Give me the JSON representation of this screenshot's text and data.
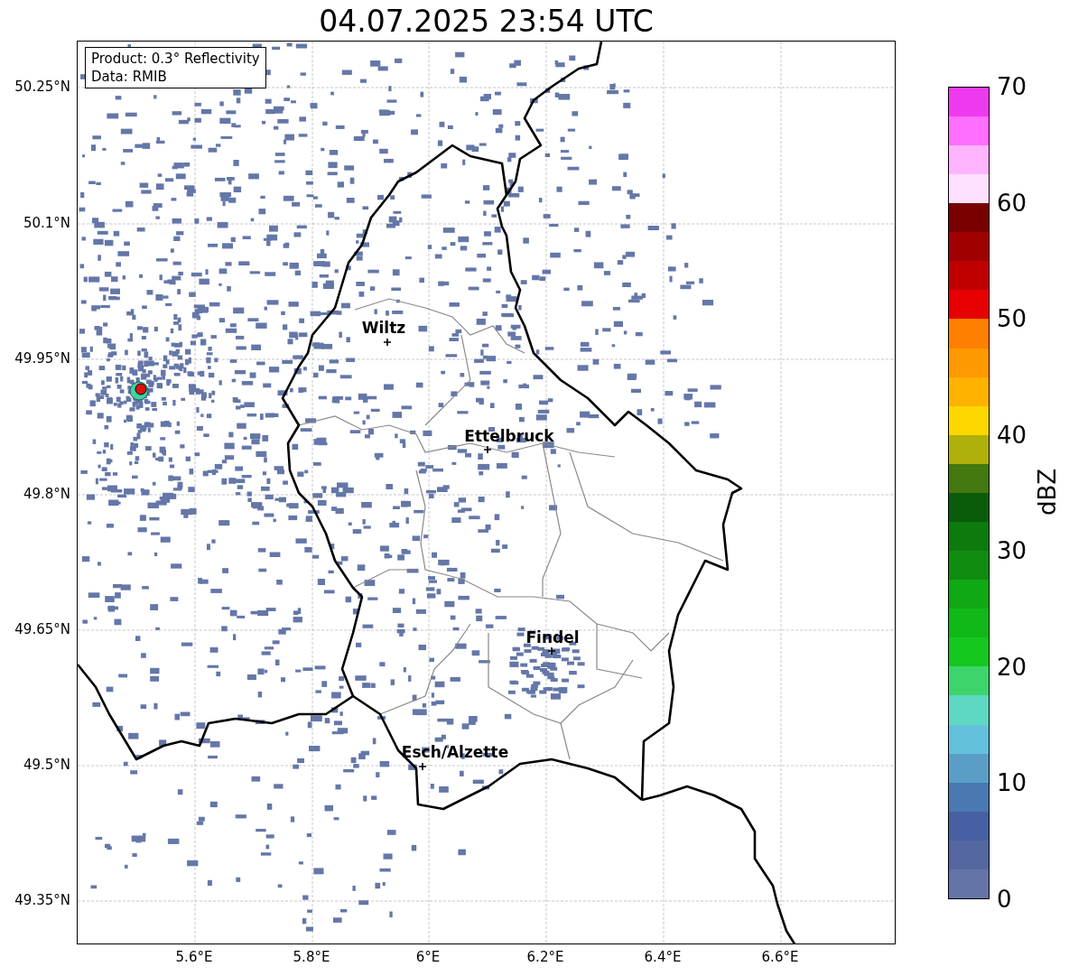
{
  "title": "04.07.2025 23:54 UTC",
  "info_box": {
    "lines": [
      "Product: 0.3° Reflectivity",
      "Data: RMIB"
    ]
  },
  "map": {
    "kind": "map",
    "cities": [
      {
        "name": "Wiltz"
      },
      {
        "name": "Ettelbruck"
      },
      {
        "name": "Findel"
      },
      {
        "name": "Esch/Alzette"
      }
    ]
  },
  "y_ticks": [
    "50.25°N",
    "50.1°N",
    "49.95°N",
    "49.8°N",
    "49.65°N",
    "49.5°N",
    "49.35°N"
  ],
  "x_ticks": [
    "5.6°E",
    "5.8°E",
    "6°E",
    "6.2°E",
    "6.4°E",
    "6.6°E"
  ],
  "colorbar": {
    "label": "dBZ",
    "ticks": [
      "70",
      "60",
      "50",
      "40",
      "30",
      "20",
      "10",
      "0"
    ],
    "segments": [
      {
        "color": "#6474a6"
      },
      {
        "color": "#5467a0"
      },
      {
        "color": "#4760a3"
      },
      {
        "color": "#4a78b0"
      },
      {
        "color": "#5a9ec8"
      },
      {
        "color": "#64c1dc"
      },
      {
        "color": "#5ed8c2"
      },
      {
        "color": "#3ed46c"
      },
      {
        "color": "#14c81e"
      },
      {
        "color": "#10b818"
      },
      {
        "color": "#10a814"
      },
      {
        "color": "#108c10"
      },
      {
        "color": "#0c7a0c"
      },
      {
        "color": "#0a5c0a"
      },
      {
        "color": "#447810"
      },
      {
        "color": "#b0b00a"
      },
      {
        "color": "#ffd700"
      },
      {
        "color": "#ffb300"
      },
      {
        "color": "#ff9900"
      },
      {
        "color": "#ff7f00"
      },
      {
        "color": "#e60000"
      },
      {
        "color": "#c00000"
      },
      {
        "color": "#a00000"
      },
      {
        "color": "#780000"
      },
      {
        "color": "#ffe0ff"
      },
      {
        "color": "#ffb4ff"
      },
      {
        "color": "#ff6eff"
      },
      {
        "color": "#ee3aee"
      }
    ]
  }
}
